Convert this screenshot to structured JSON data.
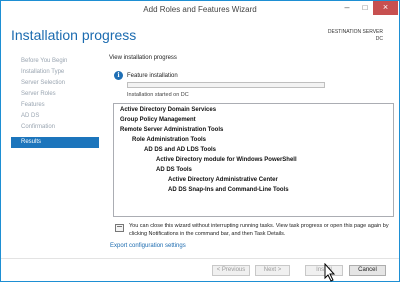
{
  "window": {
    "title": "Add Roles and Features Wizard"
  },
  "window_controls": {
    "minimize": "–",
    "maximize": "□",
    "close": "×"
  },
  "header": {
    "title": "Installation progress",
    "destination_label": "DESTINATION SERVER",
    "destination_value": "DC"
  },
  "nav": {
    "items": [
      {
        "label": "Before You Begin",
        "active": false
      },
      {
        "label": "Installation Type",
        "active": false
      },
      {
        "label": "Server Selection",
        "active": false
      },
      {
        "label": "Server Roles",
        "active": false
      },
      {
        "label": "Features",
        "active": false
      },
      {
        "label": "AD DS",
        "active": false
      },
      {
        "label": "Confirmation",
        "active": false
      },
      {
        "label": "Results",
        "active": true
      }
    ]
  },
  "main": {
    "section_label": "View installation progress",
    "info_icon": "i",
    "feature_label": "Feature installation",
    "progress_fraction": 0.0,
    "progress_text": "Installation started on DC",
    "results": [
      {
        "text": "Active Directory Domain Services",
        "level": 0
      },
      {
        "text": "Group Policy Management",
        "level": 0
      },
      {
        "text": "Remote Server Administration Tools",
        "level": 0
      },
      {
        "text": "Role Administration Tools",
        "level": 1
      },
      {
        "text": "AD DS and AD LDS Tools",
        "level": 2
      },
      {
        "text": "Active Directory module for Windows PowerShell",
        "level": 3
      },
      {
        "text": "AD DS Tools",
        "level": 3
      },
      {
        "text": "Active Directory Administrative Center",
        "level": 4
      },
      {
        "text": "AD DS Snap-Ins and Command-Line Tools",
        "level": 4
      }
    ],
    "notice": "You can close this wizard without interrupting running tasks. View task progress or open this page again by clicking Notifications in the command bar, and then Task Details.",
    "export_link": "Export configuration settings"
  },
  "footer": {
    "previous_label": "< Previous",
    "next_label": "Next >",
    "install_label": "Install",
    "cancel_label": "Cancel"
  },
  "colors": {
    "accent": "#1b6bb0",
    "nav_active": "#1c75bc",
    "progress": "#06b025",
    "close_button": "#c75050"
  }
}
